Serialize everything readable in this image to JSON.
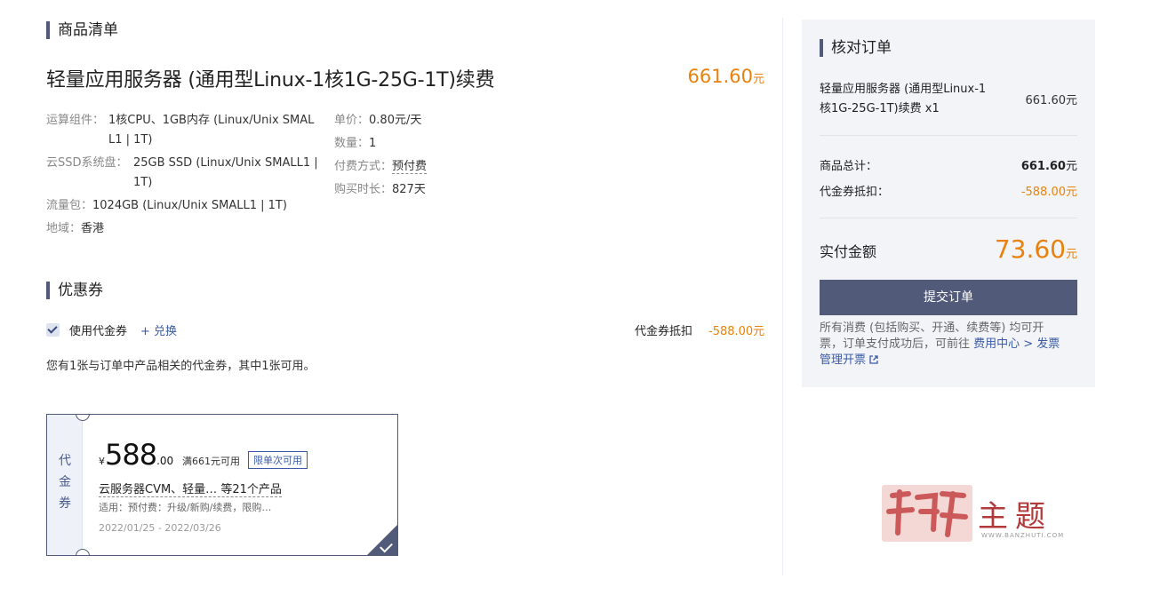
{
  "sections": {
    "goods_title": "商品清单",
    "coupon_title": "优惠券"
  },
  "product": {
    "name": "轻量应用服务器 (通用型Linux-1核1G-25G-1T)续费",
    "price": "661.60",
    "price_unit": "元",
    "specs": {
      "compute_label": "运算组件：",
      "compute_value_1": "1核CPU、1GB内存 (Linux/Unix SMAL",
      "compute_value_2": "L1 | 1T)",
      "disk_label": "云SSD系统盘：",
      "disk_value_1": "25GB SSD (Linux/Unix SMALL1 |",
      "disk_value_2": "1T)",
      "traffic_label": "流量包：",
      "traffic_value": "1024GB (Linux/Unix SMALL1 | 1T)",
      "region_label": "地域：",
      "region_value": "香港",
      "unit_price_label": "单价：",
      "unit_price_value": "0.80元/天",
      "qty_label": "数量：",
      "qty_value": "1",
      "pay_label": "付费方式：",
      "pay_value": "预付费",
      "duration_label": "购买时长：",
      "duration_value": "827天"
    }
  },
  "coupon": {
    "use_label": "使用代金券",
    "exchange_link": "+ 兑换",
    "deduct_label": "代金券抵扣",
    "deduct_value": "-588.00元",
    "summary": "您有1张与订单中产品相关的代金券，其中1张可用。",
    "card": {
      "stub_chars": [
        "代",
        "金",
        "券"
      ],
      "currency": "¥",
      "amount_int": "588",
      "amount_dec": ".00",
      "threshold": "满661元可用",
      "badge": "限单次可用",
      "products": "云服务器CVM、轻量…  等21个产品",
      "scope": "适用：预付费：升级/新购/续费，限购…",
      "validity": "2022/01/25 - 2022/03/26"
    }
  },
  "order": {
    "title": "核对订单",
    "item_line1": "轻量应用服务器 (通用型Linux-1",
    "item_line2": "核1G-25G-1T)续费 x1",
    "item_price": "661.60元",
    "total_label": "商品总计：",
    "total_value": "661.60",
    "total_unit": "元",
    "deduct_label": "代金券抵扣：",
    "deduct_value": "-588.00元",
    "pay_label": "实付金额",
    "pay_value": "73.60",
    "pay_unit": "元",
    "submit_label": "提交订单",
    "note_1": "所有消费 (包括购买、开通、续费等) 均可开",
    "note_2": "票，订单支付成功后，可前往 ",
    "note_link1": "费用中心 > 发票",
    "note_link2": "管理开票",
    "external_icon": "external-link-icon"
  },
  "watermark": {
    "text_main": "主题",
    "text_sub": "WWW.BANZHUTI.COM"
  },
  "colors": {
    "accent": "#e8820c",
    "primary": "#515a78",
    "link": "#3a5aa8",
    "panel_bg": "#f2f4f8"
  }
}
